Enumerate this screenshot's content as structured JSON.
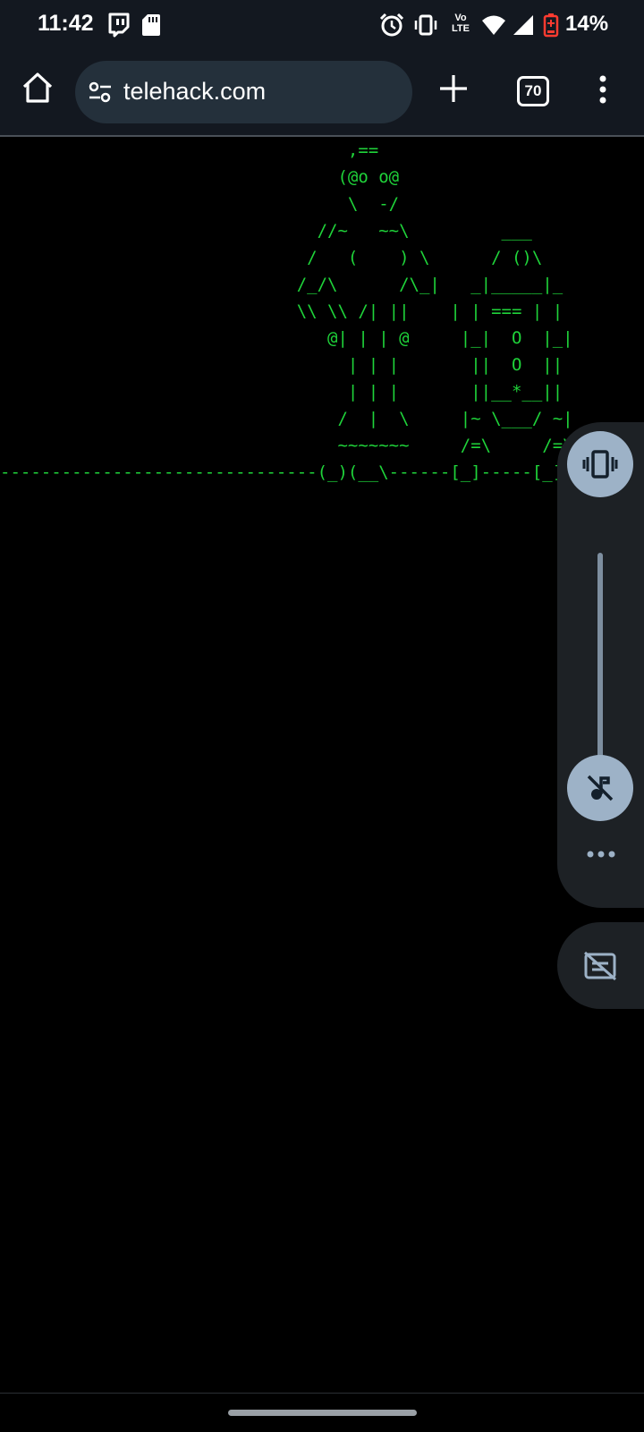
{
  "status_bar": {
    "time": "11:42",
    "left_icons": [
      "twitch-icon",
      "sd-card-icon"
    ],
    "right_icons": [
      "alarm-icon",
      "vibrate-icon",
      "volte-icon",
      "wifi-icon",
      "signal-icon",
      "battery-low-icon"
    ],
    "volte_line1": "Vo",
    "volte_line2": "LTE",
    "battery_percent": "14%",
    "battery_level": 0.14,
    "battery_color": "#ff3b30"
  },
  "browser": {
    "url": "telehack.com",
    "tab_count": "70",
    "icons": [
      "home-icon",
      "site-settings-icon",
      "plus-icon",
      "more-vert-icon"
    ]
  },
  "terminal": {
    "text_color": "#1fd43a",
    "ascii_lines": [
      "                                  ,==",
      "                                 (@o o@",
      "                                  \\  -/",
      "                               //~   ~~\\         ___",
      "                              /   (    ) \\      / ()\\",
      "                             /_/\\      /\\_|   _|_____|_",
      "                             \\\\ \\\\ /| ||    | | === | |",
      "                                @| | | @     |_|  O  |_|",
      "                                  | | |       ||  O  ||",
      "                                  | | |       ||__*__||",
      "                                 /  |  \\     |~ \\___/ ~|",
      "                                 ~~~~~~~     /=\\     /=\\",
      "-------------------------------(_)(__\\------[_]-----[_]-----"
    ]
  },
  "volume_panel": {
    "level": 0.0,
    "icons": [
      "vibrate-icon",
      "music-off-icon",
      "more-horiz-icon",
      "captions-off-icon"
    ]
  }
}
